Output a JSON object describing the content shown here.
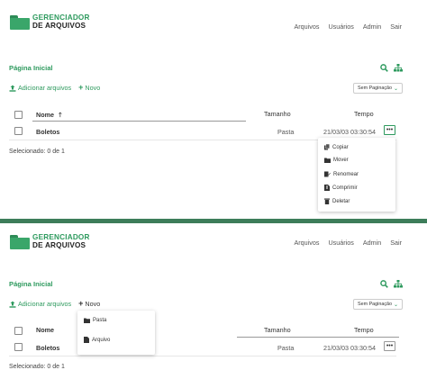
{
  "brand": {
    "line1": "GERENCIADOR",
    "line2": "DE ARQUIVOS",
    "color": "#2e9a5e"
  },
  "nav": [
    "Arquivos",
    "Usuários",
    "Admin",
    "Sair"
  ],
  "breadcrumb": "Página Inicial",
  "actions": {
    "add_files": "Adicionar arquivos",
    "new": "Novo"
  },
  "pagination": {
    "selected": "Sem Paginação"
  },
  "table": {
    "headers": {
      "name": "Nome",
      "size": "Tamanho",
      "time": "Tempo"
    },
    "rows": [
      {
        "name": "Boletos",
        "size": "Pasta",
        "time": "21/03/03 03:30:54"
      }
    ]
  },
  "selected_text": "Selecionado: 0 de 1",
  "context_menu": [
    "Copiar",
    "Mover",
    "Renomear",
    "Comprimir",
    "Deletar"
  ],
  "new_menu": [
    "Pasta",
    "Arquivo"
  ],
  "icons": {
    "search": "search-icon",
    "tree": "sitemap-icon",
    "upload": "upload-icon",
    "plus": "plus-icon",
    "sort": "arrow-up-icon",
    "more": "ellipsis-icon"
  }
}
